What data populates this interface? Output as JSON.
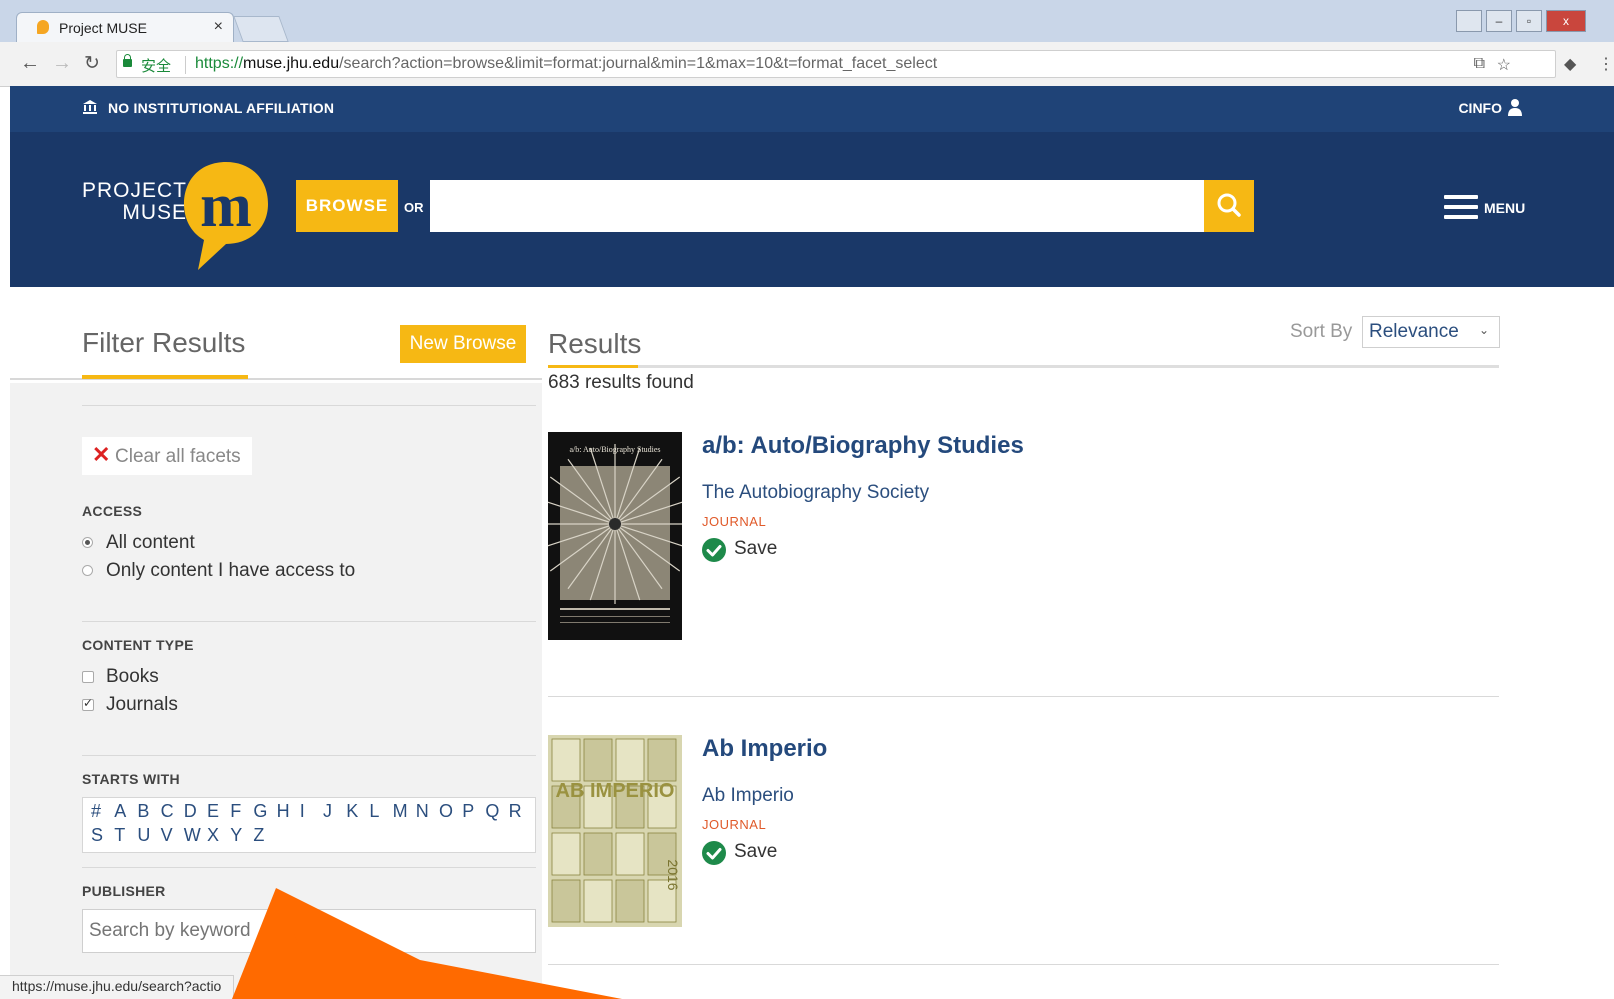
{
  "browser": {
    "tab_title": "Project MUSE",
    "tab_close": "×",
    "secure_label": "安全",
    "url_scheme": "https://",
    "url_host": "muse.jhu.edu",
    "url_path": "/search?action=browse&limit=format:journal&min=1&max=10&t=format_facet_select",
    "status_url": "https://muse.jhu.edu/search?actio"
  },
  "header": {
    "affiliation": "NO INSTITUTIONAL AFFILIATION",
    "user": "CINFO",
    "logo_line1": "PROJECT",
    "logo_line2": "MUSE",
    "browse_label": "BROWSE",
    "or_label": "OR",
    "search_placeholder": "",
    "menu_label": "MENU"
  },
  "filters": {
    "title": "Filter Results",
    "new_browse": "New Browse",
    "clear_all": "Clear all facets",
    "access": {
      "heading": "ACCESS",
      "options": [
        {
          "label": "All content",
          "selected": true
        },
        {
          "label": "Only content I have access to",
          "selected": false
        }
      ]
    },
    "content_type": {
      "heading": "CONTENT TYPE",
      "options": [
        {
          "label": "Books",
          "checked": false
        },
        {
          "label": "Journals",
          "checked": true
        }
      ]
    },
    "starts_with": {
      "heading": "STARTS WITH",
      "letters": [
        "#",
        "A",
        "B",
        "C",
        "D",
        "E",
        "F",
        "G",
        "H",
        "I",
        "J",
        "K",
        "L",
        "M",
        "N",
        "O",
        "P",
        "Q",
        "R",
        "S",
        "T",
        "U",
        "V",
        "W",
        "X",
        "Y",
        "Z"
      ]
    },
    "publisher": {
      "heading": "PUBLISHER",
      "placeholder": "Search by keyword"
    }
  },
  "results": {
    "title": "Results",
    "sort_label": "Sort By",
    "sort_value": "Relevance",
    "count": "683 results found",
    "items": [
      {
        "title": "a/b: Auto/Biography Studies",
        "publisher": "The Autobiography Society",
        "type": "JOURNAL",
        "save": "Save",
        "cover_title": "a/b: Auto/Biography Studies"
      },
      {
        "title": "Ab Imperio",
        "publisher": "Ab Imperio",
        "type": "JOURNAL",
        "save": "Save",
        "cover_title": "AB IMPERIO",
        "cover_year": "2016"
      }
    ]
  },
  "colors": {
    "brand_navy": "#1a3868",
    "brand_gold": "#f6b814",
    "link_blue": "#24497c",
    "type_orange": "#e05a2a",
    "annotation_arrow": "#ff6a00"
  }
}
